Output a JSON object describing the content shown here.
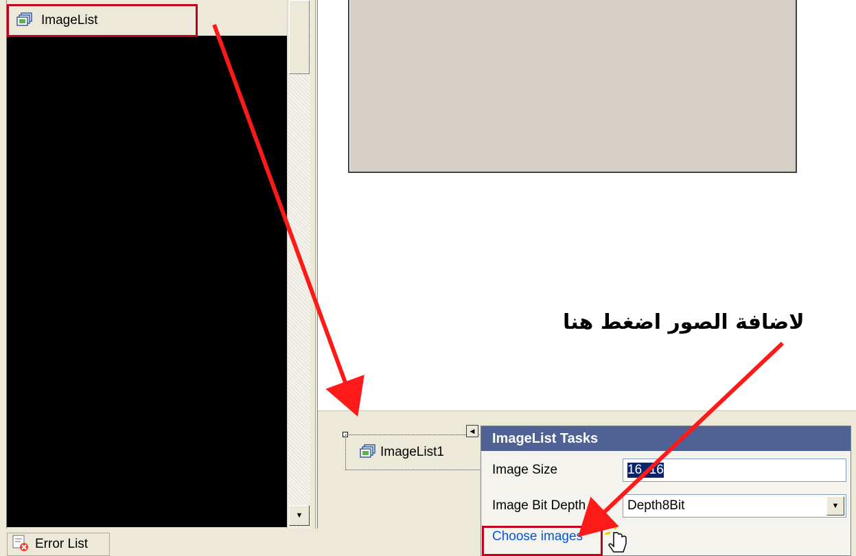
{
  "toolbox": {
    "item_label": "ImageList"
  },
  "tray": {
    "component_label": "ImageList1"
  },
  "tasks": {
    "title": "ImageList Tasks",
    "image_size_label": "Image Size",
    "image_size_value": "16, 16",
    "bit_depth_label": "Image Bit Depth",
    "bit_depth_value": "Depth8Bit",
    "choose_images_label": "Choose images"
  },
  "status": {
    "error_list_label": "Error List"
  },
  "annotation": {
    "caption": "لاضافة الصور اضغط هنا"
  },
  "colors": {
    "highlight": "#c0001a",
    "arrow": "#ff1a1a",
    "tasks_header": "#4e6296",
    "link": "#0054e3"
  }
}
